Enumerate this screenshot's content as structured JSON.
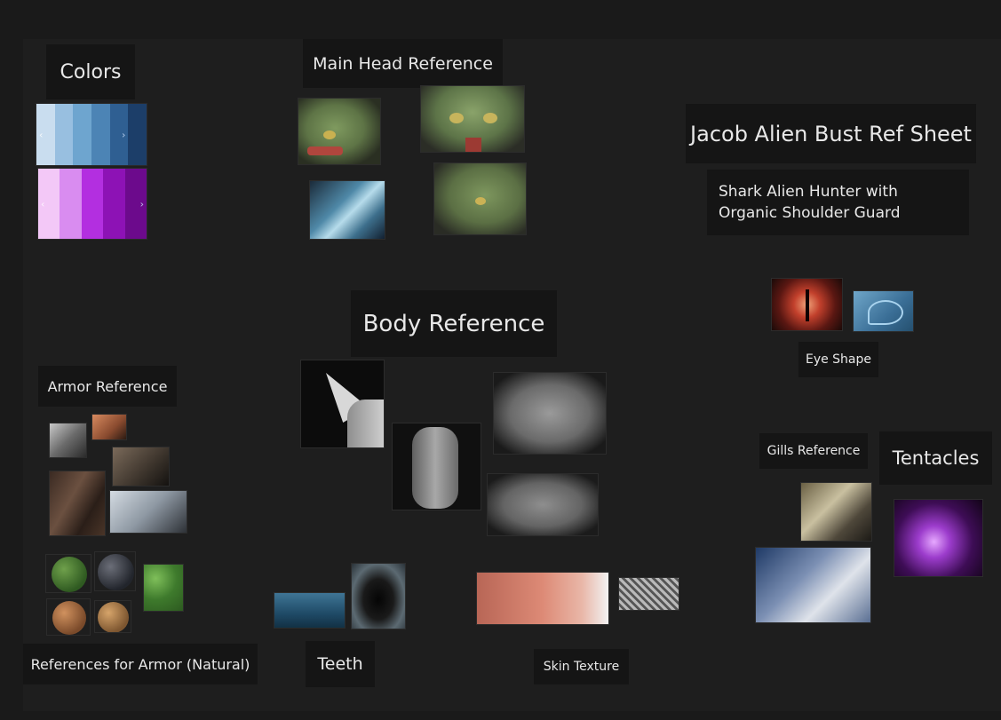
{
  "labels": {
    "colors": "Colors",
    "main_head": "Main Head Reference",
    "title": "Jacob Alien Bust Ref Sheet",
    "subtitle": "Shark Alien Hunter with Organic Shoulder Guard",
    "body_ref": "Body Reference",
    "eye_shape": "Eye Shape",
    "armor_ref": "Armor Reference",
    "gills_ref": "Gills Reference",
    "tentacles": "Tentacles",
    "armor_natural": "References for Armor (Natural)",
    "teeth": "Teeth",
    "skin_texture": "Skin Texture"
  },
  "palettes": {
    "blue": [
      "#c9ddef",
      "#98bfe0",
      "#6ea5cf",
      "#4c84b5",
      "#2f5f92",
      "#1c3e69"
    ],
    "magenta": [
      "#f3c8f7",
      "#d98cf0",
      "#b32fe0",
      "#8d12b5",
      "#6c0a8c"
    ]
  },
  "icons": {
    "chevron_left": "‹",
    "chevron_right": "›"
  }
}
